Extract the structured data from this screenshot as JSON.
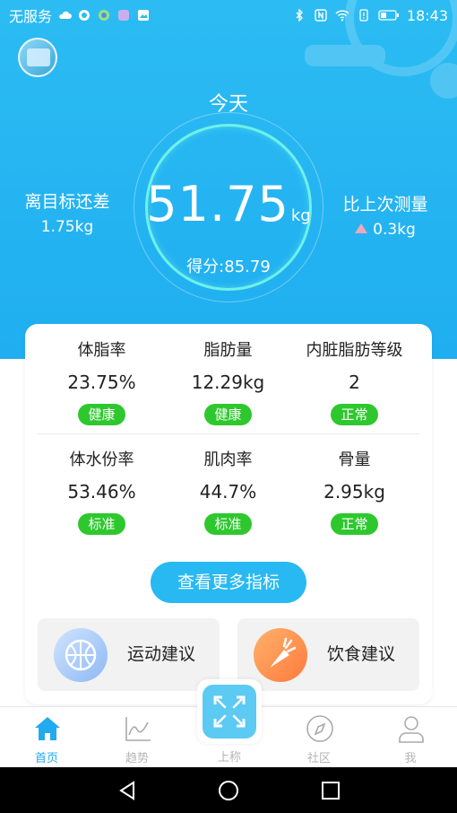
{
  "status_bar": {
    "carrier": "无服务",
    "time": "18:43"
  },
  "header": {
    "today_label": "今天",
    "weight_value": "51.75",
    "weight_unit": "kg",
    "score_text": "得分:85.79",
    "goal": {
      "label": "离目标还差",
      "value": "1.75kg"
    },
    "last": {
      "label": "比上次测量",
      "value": "0.3kg"
    }
  },
  "metrics": [
    {
      "label": "体脂率",
      "value": "23.75%",
      "badge": "健康"
    },
    {
      "label": "脂肪量",
      "value": "12.29kg",
      "badge": "健康"
    },
    {
      "label": "内脏脂肪等级",
      "value": "2",
      "badge": "正常"
    },
    {
      "label": "体水份率",
      "value": "53.46%",
      "badge": "标准"
    },
    {
      "label": "肌肉率",
      "value": "44.7%",
      "badge": "标准"
    },
    {
      "label": "骨量",
      "value": "2.95kg",
      "badge": "正常"
    }
  ],
  "more_button": "查看更多指标",
  "advice": [
    {
      "label": "运动建议",
      "icon": "basketball-icon"
    },
    {
      "label": "饮食建议",
      "icon": "carrot-icon"
    }
  ],
  "tabs": [
    {
      "label": "首页",
      "icon": "home-icon"
    },
    {
      "label": "趋势",
      "icon": "trend-chart-icon"
    },
    {
      "label": "上称",
      "icon": "scale-icon"
    },
    {
      "label": "社区",
      "icon": "compass-icon"
    },
    {
      "label": "我",
      "icon": "user-icon"
    }
  ],
  "colors": {
    "primary": "#22aaf0",
    "badge_green": "#2ec82e",
    "ring": "#6ff1e6",
    "up_arrow": "#f3a6b9"
  }
}
